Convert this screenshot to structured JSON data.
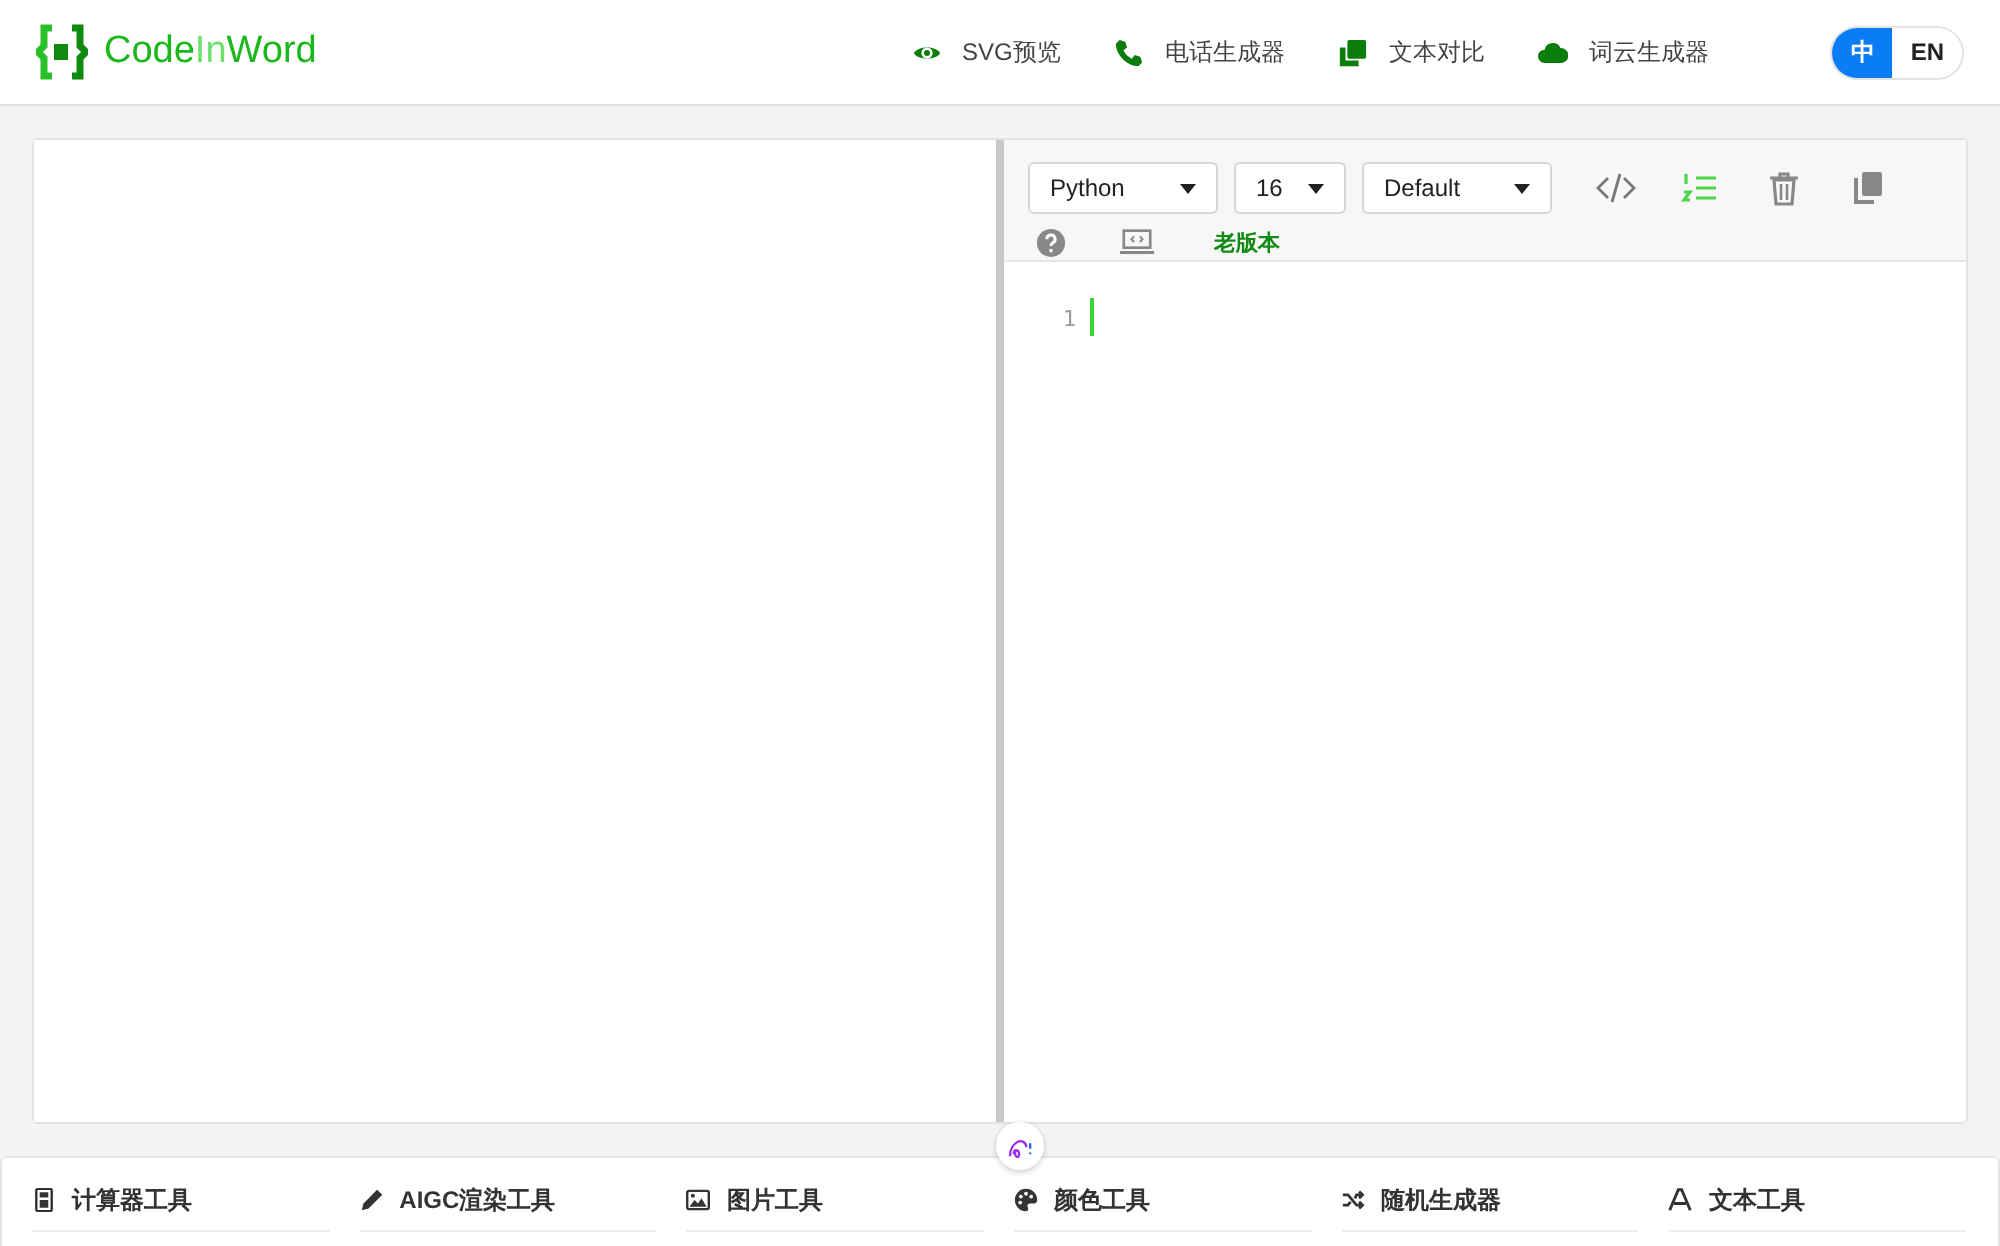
{
  "header": {
    "logo_parts": [
      {
        "text": "Code",
        "kind": "dark"
      },
      {
        "text": "In",
        "kind": "light"
      },
      {
        "text": "Word",
        "kind": "dark"
      }
    ],
    "nav": [
      {
        "label": "SVG预览",
        "kind": "eye"
      },
      {
        "label": "电话生成器",
        "kind": "phone"
      },
      {
        "label": "文本对比",
        "kind": "copy"
      },
      {
        "label": "词云生成器",
        "kind": "cloud"
      }
    ],
    "languages": [
      {
        "label": "中",
        "selected": true
      },
      {
        "label": "EN",
        "selected": false
      }
    ]
  },
  "editor": {
    "selects": [
      {
        "value": "Python",
        "kind": "wide"
      },
      {
        "value": "16",
        "kind": "narrow"
      },
      {
        "value": "Default",
        "kind": "wide"
      }
    ],
    "line_numbers_on": true,
    "old_version_link": "老版本",
    "line_numbers": [
      "1"
    ]
  },
  "tool_categories": [
    {
      "label": "计算器工具",
      "kind": "calculator"
    },
    {
      "label": "AIGC渲染工具",
      "kind": "pencil"
    },
    {
      "label": "图片工具",
      "kind": "image"
    },
    {
      "label": "颜色工具",
      "kind": "palette"
    },
    {
      "label": "随机生成器",
      "kind": "shuffle"
    },
    {
      "label": "文本工具",
      "kind": "font"
    }
  ]
}
